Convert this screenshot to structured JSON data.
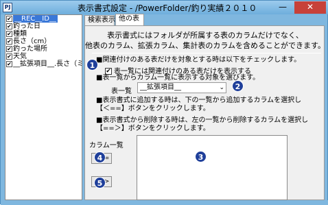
{
  "app": {
    "icon_text": "PJ",
    "title": "表示書式設定 - /PowerFolder/釣り実績２０１０",
    "min_glyph": "—",
    "close_glyph": "✕"
  },
  "field_list": {
    "items": [
      {
        "label": "__REC__ID__",
        "checked": true,
        "selected": true
      },
      {
        "label": "釣った日",
        "checked": true
      },
      {
        "label": "種類",
        "checked": true
      },
      {
        "label": "長さ（cm）",
        "checked": true
      },
      {
        "label": "釣った場所",
        "checked": true
      },
      {
        "label": "天気",
        "checked": true
      },
      {
        "label": "__拡張項目__.長さ（ミリ",
        "checked": true
      }
    ]
  },
  "tabs": [
    {
      "label": "検索表示",
      "active": false
    },
    {
      "label": "他の表",
      "active": true
    }
  ],
  "panel": {
    "intro_line1": "表示書式にはフォルダが所属する表のカラムだけでなく、",
    "intro_line2": "他表のカラム、拡張カラム、集計表のカラムを含めることができます。",
    "note1": "■関連付けのある表だけを対象とする時は以下をチェックします。",
    "checkbox_label": "表一覧には関連付けのある表だけを表示する",
    "checkbox_mark": "✔",
    "note2": "■表一覧からカラム一覧に表示する対象を選びます。",
    "table_label": "表一覧",
    "table_value": "__拡張項目__",
    "dropdown_arrow": "⌄",
    "note3_line1": "■表示書式に追加する時は、下の一覧から追加するカラムを選択し",
    "note3_line2": "【＜==】ボタンをクリックします。",
    "note4_line1": "■表示書式から削除する時は、左の一覧から削除するカラムを選択し",
    "note4_line2": "【==＞】ボタンをクリックします。",
    "column_label": "カラム一覧",
    "add_button": "<==",
    "remove_button": "==>"
  },
  "badges": [
    "1",
    "2",
    "3",
    "4",
    "5"
  ],
  "colors": {
    "badge": "#1f3f9a",
    "selection": "#3a78d8",
    "titlebar": "#7fb7df"
  }
}
